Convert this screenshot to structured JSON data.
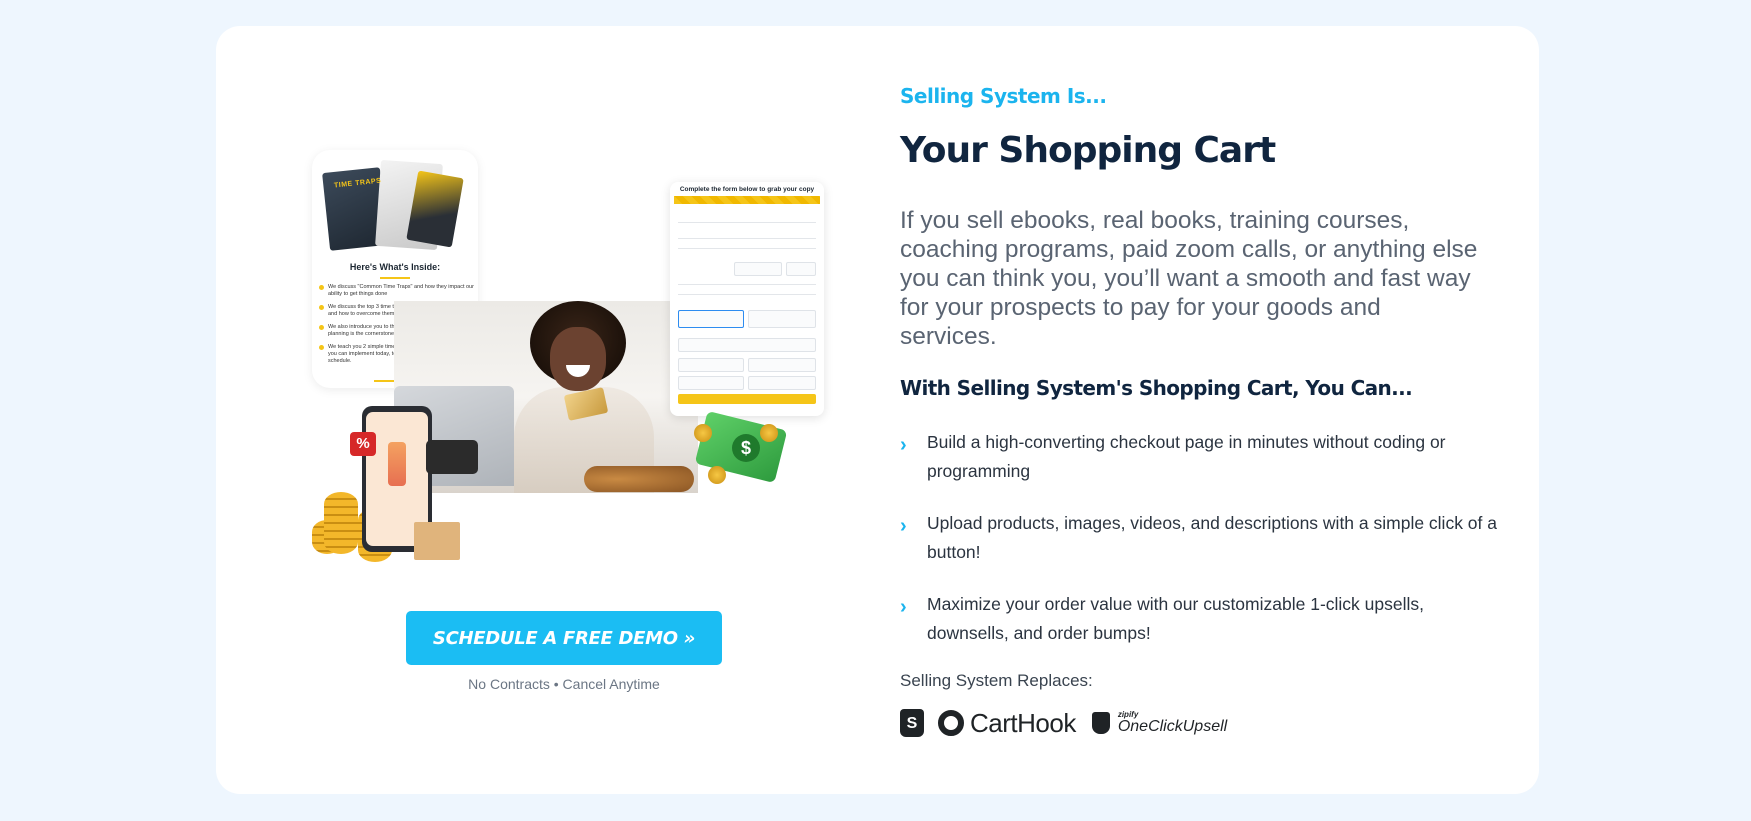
{
  "left": {
    "ebook": {
      "cover_title": "TIME TRAPS",
      "inside_title": "Here's What's Inside:",
      "items": [
        "We discuss \"Common Time Traps\" and how they impact our ability to get things done",
        "We discuss the top 3 time traps entrepreneurs struggle with and how to overcome them",
        "We also introduce you to the concept of \"planning\" and why planning is the cornerstone of productivity.",
        "We teach you 2 simple time management techniques that you can implement today, to start taking control of your schedule."
      ]
    },
    "form": {
      "title": "Complete the form below to grab your copy"
    },
    "percent_badge": "%",
    "cash_symbol": "$",
    "cta_label": "SCHEDULE A FREE DEMO »",
    "cta_sub": "No Contracts • Cancel Anytime"
  },
  "right": {
    "eyebrow": "Selling System Is...",
    "headline": "Your Shopping Cart",
    "intro": "If you sell ebooks, real books, training courses, coaching programs, paid zoom calls, or anything else you can think you, you’ll want a smooth and fast way for your prospects to pay for your goods and services.",
    "subhead": "With Selling System's Shopping Cart, You Can...",
    "bullets": [
      "Build a high-converting checkout page in minutes without coding or programming",
      "Upload products, images, videos, and descriptions with a simple click of a button!",
      "Maximize your order value with our customizable 1-click upsells, downsells, and order bumps!"
    ],
    "replaces_label": "Selling System Replaces:",
    "logos": {
      "shopify_glyph": "S",
      "carthook": "CartHook",
      "zipify_small": "zipify",
      "zipify": "OneClickUpsell"
    }
  },
  "colors": {
    "background": "#eef6fe",
    "accent": "#1bbdf3",
    "heading": "#10253f",
    "body_text": "#5a6472"
  }
}
